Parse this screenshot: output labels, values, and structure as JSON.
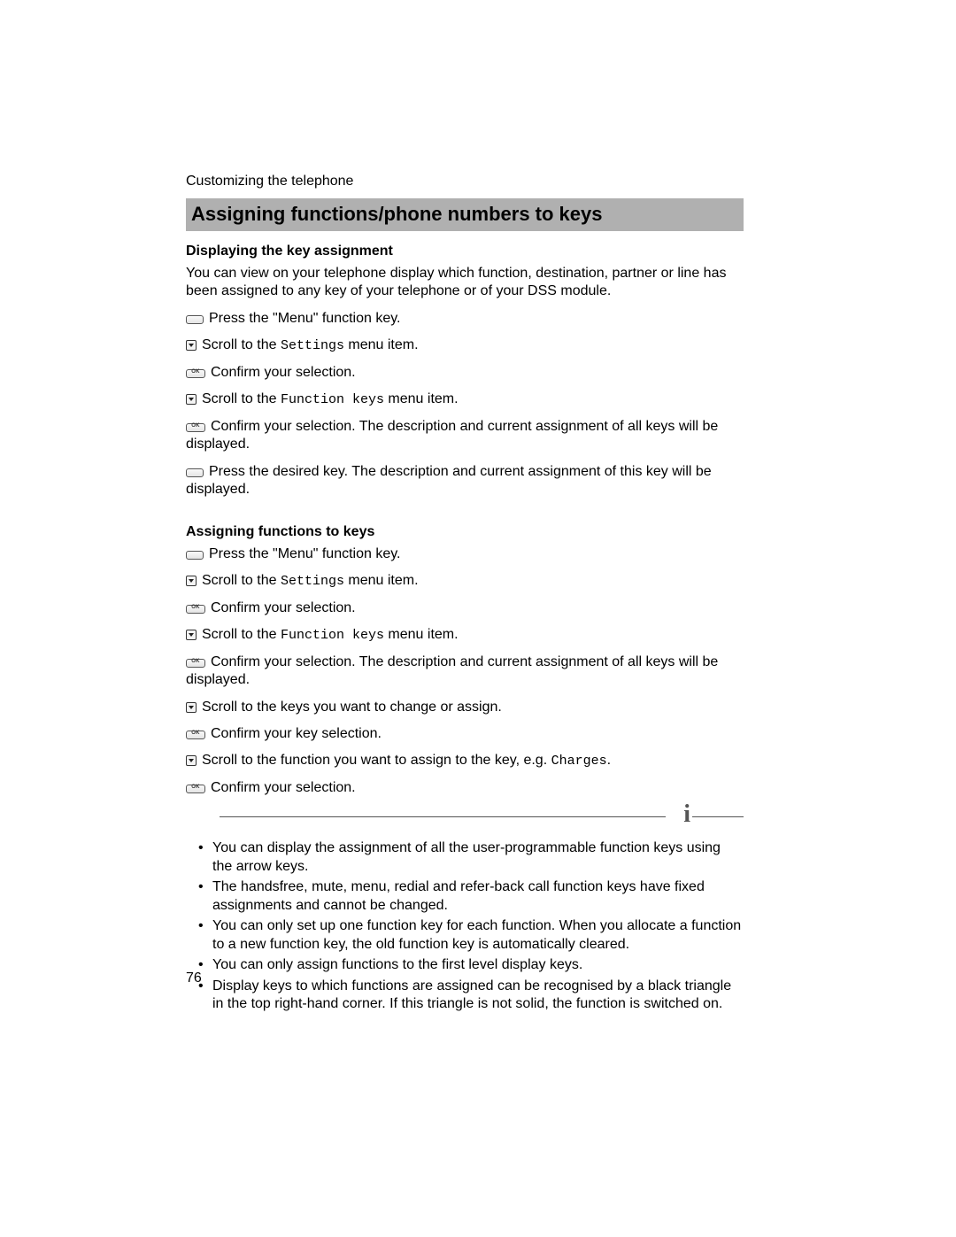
{
  "running_head": "Customizing the telephone",
  "title": "Assigning functions/phone numbers to keys",
  "section1": {
    "heading": "Displaying the key assignment",
    "intro": "You can view on your telephone display which function, destination, partner or line has been assigned to any key of your telephone or of your DSS module.",
    "steps": [
      {
        "icon": "key",
        "pre": "Press the \"Menu\" function key."
      },
      {
        "icon": "arrow",
        "pre": "Scroll to the ",
        "code": "Settings",
        "post": " menu item."
      },
      {
        "icon": "ok",
        "pre": "Confirm your selection."
      },
      {
        "icon": "arrow",
        "pre": "Scroll to the ",
        "code": "Function keys",
        "post": " menu item."
      },
      {
        "icon": "ok",
        "pre": "Confirm your selection. The description and current assignment of all keys will be displayed."
      },
      {
        "icon": "key",
        "pre": "Press the desired key. The description and current assignment of this key will be displayed."
      }
    ]
  },
  "section2": {
    "heading": "Assigning functions to keys",
    "steps": [
      {
        "icon": "key",
        "pre": "Press the \"Menu\" function key."
      },
      {
        "icon": "arrow",
        "pre": "Scroll to the ",
        "code": "Settings",
        "post": " menu item."
      },
      {
        "icon": "ok",
        "pre": "Confirm your selection."
      },
      {
        "icon": "arrow",
        "pre": "Scroll to the ",
        "code": "Function keys",
        "post": " menu item."
      },
      {
        "icon": "ok",
        "pre": "Confirm your selection. The description and current assignment of all keys will be displayed."
      },
      {
        "icon": "arrow",
        "pre": "Scroll to the keys you want to change or assign."
      },
      {
        "icon": "ok",
        "pre": "Confirm your key selection."
      },
      {
        "icon": "arrow",
        "pre": "Scroll to the function you want to assign to the key, e.g. ",
        "code": "Charges",
        "post": "."
      },
      {
        "icon": "ok",
        "pre": "Confirm your selection."
      }
    ]
  },
  "info_glyph": "i",
  "notes": [
    "You can display the assignment of all the user-programmable function keys using the arrow keys.",
    "The handsfree, mute, menu, redial and refer-back call function keys have fixed assignments and cannot be changed.",
    "You can only set up one function key for each function. When you allocate a function to a new function key, the old function key is automatically cleared.",
    "You can only assign functions to the first level display keys.",
    "Display keys to which functions are assigned can be recognised by a black triangle in the top right-hand corner. If this triangle is not solid, the function is switched on."
  ],
  "page_number": "76"
}
